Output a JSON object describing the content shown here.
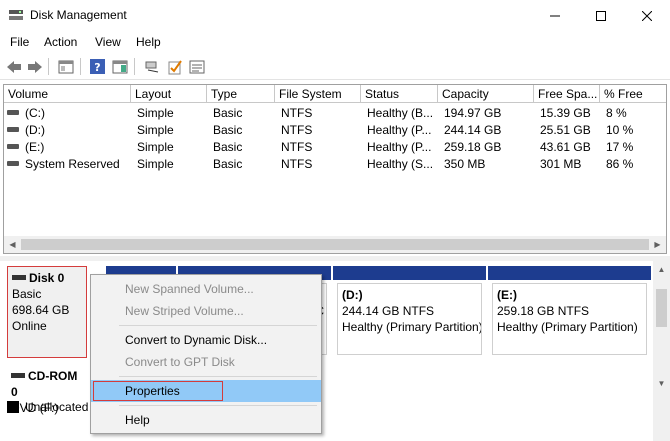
{
  "window": {
    "title": "Disk Management"
  },
  "menu": [
    "File",
    "Action",
    "View",
    "Help"
  ],
  "grid": {
    "columns": [
      "Volume",
      "Layout",
      "Type",
      "File System",
      "Status",
      "Capacity",
      "Free Spa...",
      "% Free"
    ],
    "rows": [
      [
        "(C:)",
        "Simple",
        "Basic",
        "NTFS",
        "Healthy (B...",
        "194.97 GB",
        "15.39 GB",
        "8 %"
      ],
      [
        "(D:)",
        "Simple",
        "Basic",
        "NTFS",
        "Healthy (P...",
        "244.14 GB",
        "25.51 GB",
        "10 %"
      ],
      [
        "(E:)",
        "Simple",
        "Basic",
        "NTFS",
        "Healthy (P...",
        "259.18 GB",
        "43.61 GB",
        "17 %"
      ],
      [
        "System Reserved",
        "Simple",
        "Basic",
        "NTFS",
        "Healthy (S...",
        "350 MB",
        "301 MB",
        "86 %"
      ]
    ]
  },
  "disk0": {
    "name": "Disk 0",
    "type": "Basic",
    "size": "698.64 GB",
    "status": "Online"
  },
  "partitions": [
    {
      "name": "(D:)",
      "size": "244.14 GB NTFS",
      "status": "Healthy (Primary Partition)"
    },
    {
      "name": "(E:)",
      "size": "259.18 GB NTFS",
      "status": "Healthy (Primary Partition)"
    }
  ],
  "partial_text": "C",
  "cdrom": {
    "name": "CD-ROM 0",
    "type": "DVD (F:)"
  },
  "legend": {
    "unallocated": "Unallocated"
  },
  "context_menu": {
    "new_spanned": "New Spanned Volume...",
    "new_striped": "New Striped Volume...",
    "convert_dynamic": "Convert to Dynamic Disk...",
    "convert_gpt": "Convert to GPT Disk",
    "properties": "Properties",
    "help": "Help"
  },
  "colors": {
    "partition_bar": "#1d3c8f",
    "highlight": "#91c9f7",
    "selection_border": "#d43c3c"
  }
}
